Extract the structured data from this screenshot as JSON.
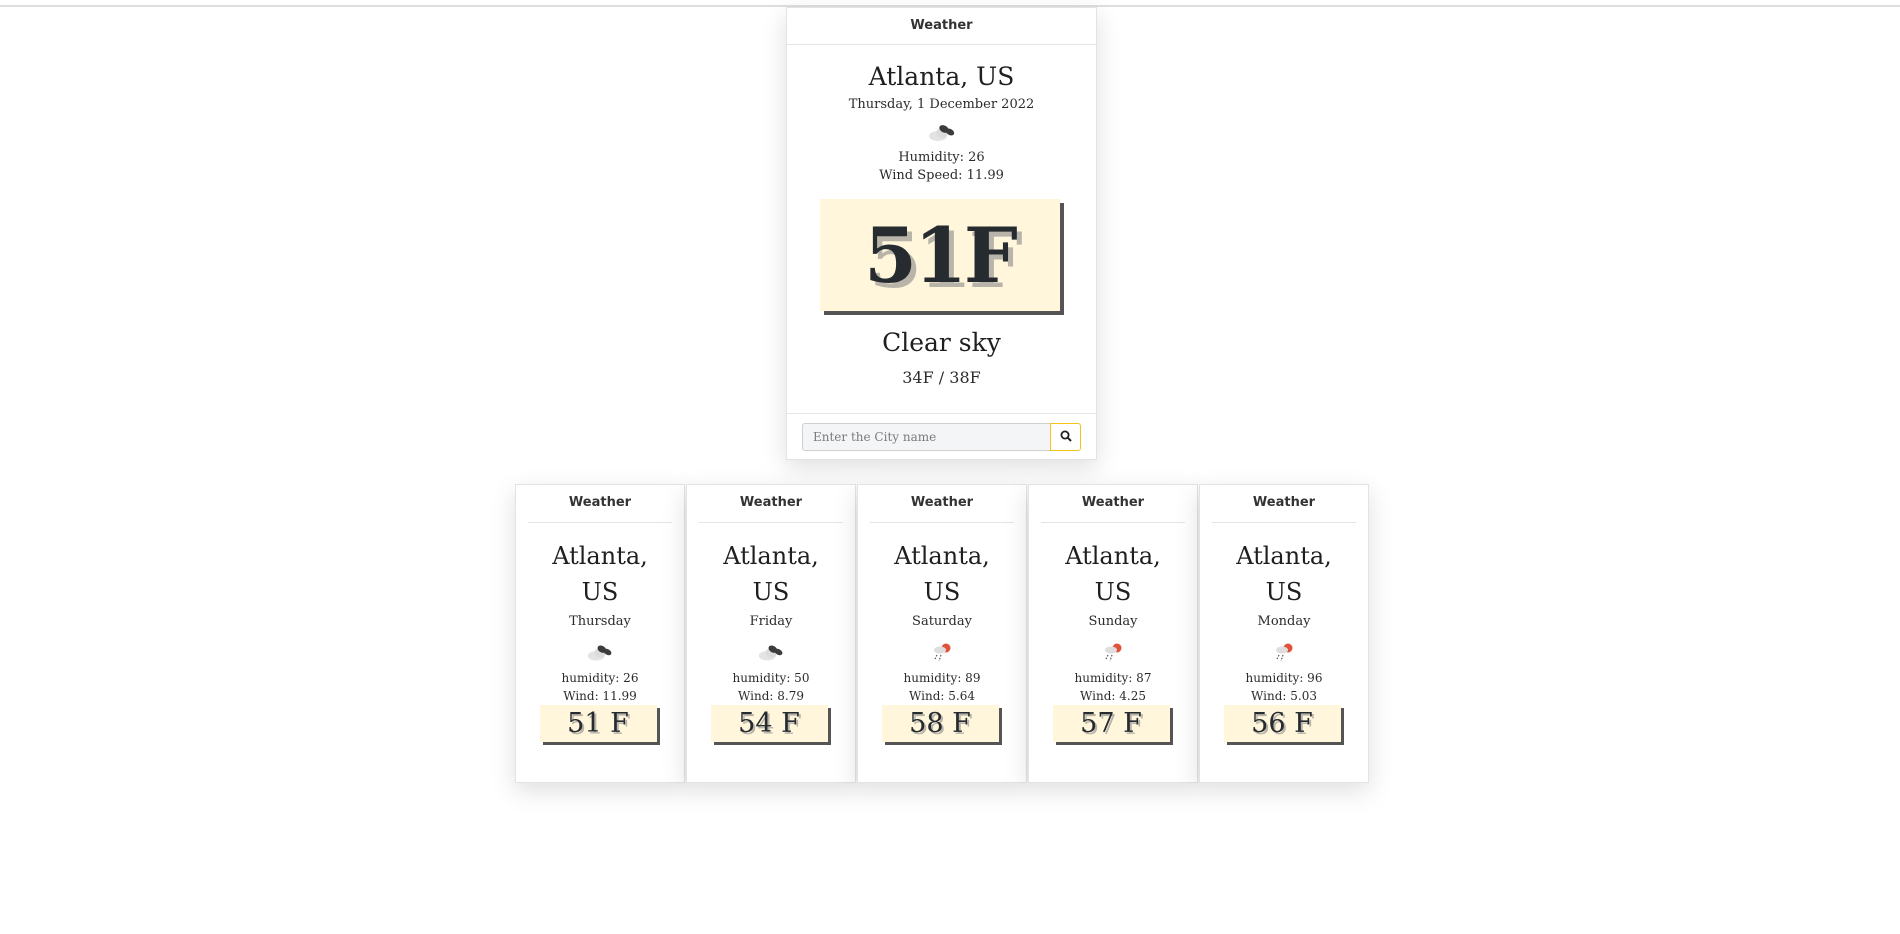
{
  "main": {
    "header": "Weather",
    "city": "Atlanta, US",
    "date": "Thursday, 1 December 2022",
    "icon": "cloudy-icon",
    "humidity": "Humidity: 26",
    "wind": "Wind Speed: 11.99",
    "temp": "51F",
    "description": "Clear sky",
    "minmax": "34F / 38F",
    "search_placeholder": "Enter the City name"
  },
  "forecast": [
    {
      "header": "Weather",
      "city_line1": "Atlanta,",
      "city_line2": "US",
      "day": "Thursday",
      "icon": "cloudy-icon",
      "humidity": "humidity: 26",
      "wind": "Wind: 11.99",
      "temp": "51 F"
    },
    {
      "header": "Weather",
      "city_line1": "Atlanta,",
      "city_line2": "US",
      "day": "Friday",
      "icon": "cloudy-icon",
      "humidity": "humidity: 50",
      "wind": "Wind: 8.79",
      "temp": "54 F"
    },
    {
      "header": "Weather",
      "city_line1": "Atlanta,",
      "city_line2": "US",
      "day": "Saturday",
      "icon": "rain-icon",
      "humidity": "humidity: 89",
      "wind": "Wind: 5.64",
      "temp": "58 F"
    },
    {
      "header": "Weather",
      "city_line1": "Atlanta,",
      "city_line2": "US",
      "day": "Sunday",
      "icon": "rain-icon",
      "humidity": "humidity: 87",
      "wind": "Wind: 4.25",
      "temp": "57 F"
    },
    {
      "header": "Weather",
      "city_line1": "Atlanta,",
      "city_line2": "US",
      "day": "Monday",
      "icon": "rain-icon",
      "humidity": "humidity: 96",
      "wind": "Wind: 5.03",
      "temp": "56 F"
    }
  ],
  "colors": {
    "temp_bg": "#fff6db",
    "accent": "#f0c419",
    "shadow": "#555555"
  }
}
